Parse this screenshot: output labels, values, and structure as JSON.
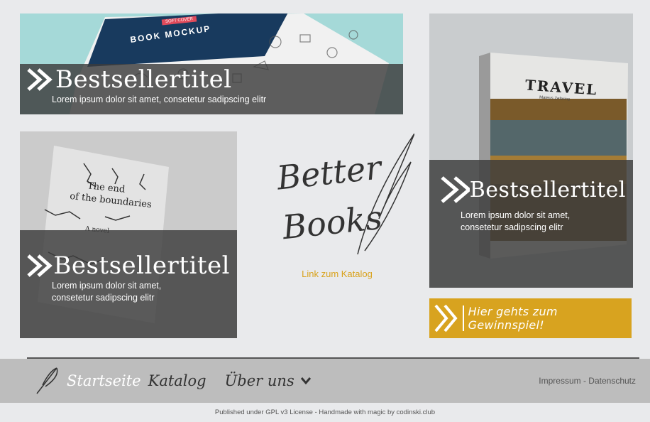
{
  "tiles": [
    {
      "title": "Bestsellertitel",
      "subtitle": "Lorem ipsum dolor sit amet, consetetur sadipscing elitr",
      "mockup_text": "BOOK MOCKUP",
      "badge": "SOFT COVER"
    },
    {
      "title": "Bestsellertitel",
      "subtitle_line1": "Lorem ipsum dolor sit amet,",
      "subtitle_line2": "consetetur sadipscing elitr",
      "book_title_line1": "The end",
      "book_title_line2": "of the boundaries",
      "book_sub": "A novel"
    },
    {
      "title": "Bestsellertitel",
      "subtitle_line1": "Lorem ipsum dolor sit amet,",
      "subtitle_line2": "consetetur sadipscing elitr",
      "book_title": "TRAVEL",
      "book_author": "Mateus Zeferino"
    }
  ],
  "logo": {
    "line1": "Better",
    "line2": "Books"
  },
  "catalog_link": "Link zum Katalog",
  "cta": {
    "label": "Hier gehts zum Gewinnspiel!"
  },
  "nav": {
    "items": [
      "Startseite",
      "Katalog",
      "Über uns"
    ],
    "legal": {
      "impressum": "Impressum",
      "sep": " - ",
      "datenschutz": "Datenschutz"
    }
  },
  "footer": {
    "text": "Published under GPL v3 License - Handmade with magic by codinski.club"
  },
  "colors": {
    "accent": "#d8a31f",
    "overlay": "#3c3c3c",
    "nav": "#bdbdbd"
  }
}
